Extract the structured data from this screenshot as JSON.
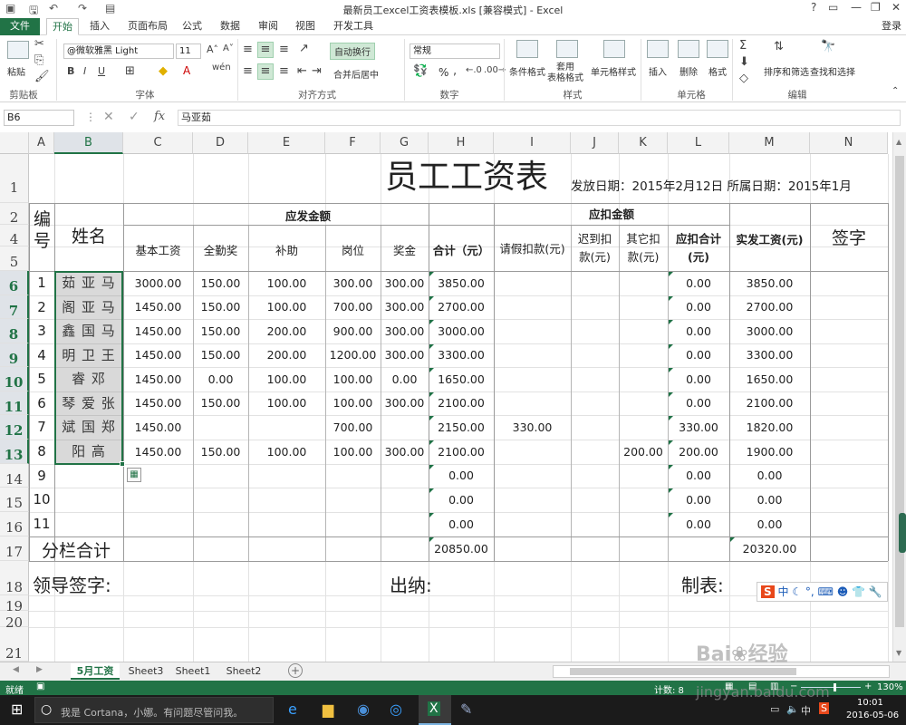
{
  "titlebar": {
    "title": "最新员工excel工资表模板.xls  [兼容模式] - Excel",
    "help": "?",
    "login": "登录"
  },
  "tabs": [
    "文件",
    "开始",
    "插入",
    "页面布局",
    "公式",
    "数据",
    "审阅",
    "视图",
    "开发工具"
  ],
  "ribbon": {
    "paste": "粘贴",
    "clipboard": "剪贴板",
    "font_name": "@微软雅黑 Light",
    "font_size": "11",
    "font_group": "字体",
    "wrap": "自动换行",
    "merge": "合并后居中",
    "align_group": "对齐方式",
    "number_format": "常规",
    "number_group": "数字",
    "percent": "%",
    "cond_format": "条件格式",
    "table_format": "套用\n表格格式",
    "cell_style": "单元格样式",
    "style_group": "样式",
    "insert": "插入",
    "delete": "删除",
    "format": "格式",
    "cells_group": "单元格",
    "sort": "排序和筛选",
    "find": "查找和选择",
    "edit_group": "编辑"
  },
  "formula": {
    "namebox": "B6",
    "fx": "fx",
    "value": "马亚茹"
  },
  "columns": [
    "A",
    "B",
    "C",
    "D",
    "E",
    "F",
    "G",
    "H",
    "I",
    "J",
    "K",
    "L",
    "M",
    "N"
  ],
  "selected_col": "B",
  "rows": [
    "1",
    "2",
    "4",
    "5",
    "6",
    "7",
    "8",
    "9",
    "10",
    "11",
    "12",
    "13",
    "14",
    "15",
    "16",
    "17",
    "18",
    "19",
    "20",
    "21"
  ],
  "selected_rows": [
    "6",
    "7",
    "8",
    "9",
    "10",
    "11",
    "12",
    "13"
  ],
  "sheet": {
    "title": "员工工资表",
    "issue": "发放日期：2015年2月12日 所属日期：2015年1月",
    "h_num": "编\n号",
    "h_name": "姓名",
    "h_payable": "应发金额",
    "h_deduct": "应扣金额",
    "h_basic": "基本工资",
    "h_attend": "全勤奖",
    "h_subsidy": "补助",
    "h_post": "岗位",
    "h_bonus": "奖金",
    "h_total": "合计（元）",
    "h_leave": "请假扣款(元)",
    "h_late": "迟到扣\n款(元)",
    "h_other": "其它扣\n款(元)",
    "h_dtotal": "应扣合计\n(元)",
    "h_net": "实发工资(元)",
    "h_sign": "签字",
    "records": [
      [
        "1",
        "茹 亚 马",
        "3000.00",
        "150.00",
        "100.00",
        "300.00",
        "300.00",
        "3850.00",
        "",
        "",
        "",
        "0.00",
        "3850.00"
      ],
      [
        "2",
        "阁 亚 马",
        "1450.00",
        "150.00",
        "100.00",
        "700.00",
        "300.00",
        "2700.00",
        "",
        "",
        "",
        "0.00",
        "2700.00"
      ],
      [
        "3",
        "鑫 国 马",
        "1450.00",
        "150.00",
        "200.00",
        "900.00",
        "300.00",
        "3000.00",
        "",
        "",
        "",
        "0.00",
        "3000.00"
      ],
      [
        "4",
        "明 卫 王",
        "1450.00",
        "150.00",
        "200.00",
        "1200.00",
        "300.00",
        "3300.00",
        "",
        "",
        "",
        "0.00",
        "3300.00"
      ],
      [
        "5",
        "睿 邓",
        "1450.00",
        "0.00",
        "100.00",
        "100.00",
        "0.00",
        "1650.00",
        "",
        "",
        "",
        "0.00",
        "1650.00"
      ],
      [
        "6",
        "琴 爱 张",
        "1450.00",
        "150.00",
        "100.00",
        "100.00",
        "300.00",
        "2100.00",
        "",
        "",
        "",
        "0.00",
        "2100.00"
      ],
      [
        "7",
        "斌 国 郑",
        "1450.00",
        "",
        "",
        "700.00",
        "",
        "2150.00",
        "330.00",
        "",
        "",
        "330.00",
        "1820.00"
      ],
      [
        "8",
        "阳 高",
        "1450.00",
        "150.00",
        "100.00",
        "100.00",
        "300.00",
        "2100.00",
        "",
        "",
        "200.00",
        "200.00",
        "1900.00"
      ],
      [
        "9",
        "",
        "",
        "",
        "",
        "",
        "",
        "0.00",
        "",
        "",
        "",
        "0.00",
        "0.00"
      ],
      [
        "10",
        "",
        "",
        "",
        "",
        "",
        "",
        "0.00",
        "",
        "",
        "",
        "0.00",
        "0.00"
      ],
      [
        "11",
        "",
        "",
        "",
        "",
        "",
        "",
        "0.00",
        "",
        "",
        "",
        "0.00",
        "0.00"
      ]
    ],
    "subtotal_label": "分栏合计",
    "subtotal_total": "20850.00",
    "subtotal_net": "20320.00",
    "sig_leader": "领导签字:",
    "sig_cashier": "出纳:",
    "sig_maker": "制表:"
  },
  "sheet_tabs": [
    "5月工资",
    "Sheet3",
    "Sheet1",
    "Sheet2"
  ],
  "active_sheet": "5月工资",
  "status": {
    "ready": "就绪",
    "count": "计数: 8",
    "zoom": "130%"
  },
  "taskbar": {
    "cortana": "我是 Cortana，小娜。有问题尽管问我。",
    "time": "10:01",
    "date": "2016-05-06",
    "ime": "中"
  },
  "watermark": "jingyan.baidu.com",
  "colors": {
    "accent": "#217346",
    "selection": "#c6c6c6"
  }
}
